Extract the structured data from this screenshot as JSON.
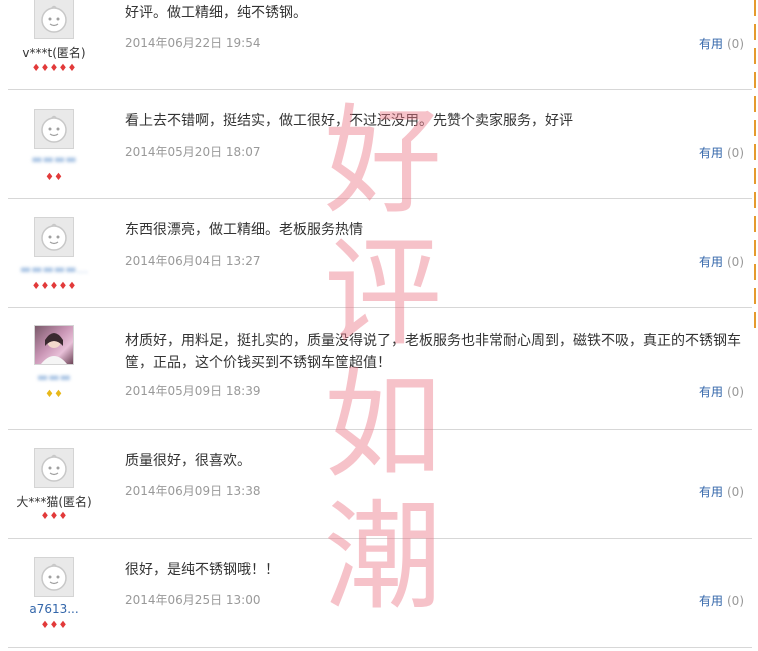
{
  "reviews": [
    {
      "username": "v***t(匿名)",
      "rank": "♦♦♦♦♦",
      "comment": "好评。做工精细，纯不锈钢。",
      "date": "2014年06月22日 19:54",
      "useful_label": "有用",
      "useful_count": "(0)"
    },
    {
      "username": "",
      "rank": "♦♦",
      "comment": "看上去不错啊，挺结实，做工很好，不过还没用。先赞个卖家服务，好评",
      "date": "2014年05月20日 18:07",
      "useful_label": "有用",
      "useful_count": "(0)"
    },
    {
      "username": "",
      "rank": "♦♦♦♦♦",
      "comment": "东西很漂亮，做工精细。老板服务热情",
      "date": "2014年06月04日 13:27",
      "useful_label": "有用",
      "useful_count": "(0)"
    },
    {
      "username": "",
      "rank": "♦♦",
      "comment": "材质好，用料足，挺扎实的，质量没得说了，老板服务也非常耐心周到，磁铁不吸，真正的不锈钢车筐，正品，这个价钱买到不锈钢车筐超值！",
      "date": "2014年05月09日 18:39",
      "useful_label": "有用",
      "useful_count": "(0)"
    },
    {
      "username": "大***猫(匿名)",
      "rank": "♦♦♦",
      "comment": "质量很好，很喜欢。",
      "date": "2014年06月09日 13:38",
      "useful_label": "有用",
      "useful_count": "(0)"
    },
    {
      "username": "a7613...",
      "rank": "♦♦♦",
      "comment": "很好，是纯不锈钢哦！！",
      "date": "2014年06月25日 13:00",
      "useful_label": "有用",
      "useful_count": "(0)"
    }
  ],
  "watermark": {
    "chars": [
      "好",
      "评",
      "如",
      "潮"
    ]
  },
  "colors": {
    "link": "#3366aa",
    "date": "#999999",
    "heart_rank": "#e23a3a",
    "diamond_rank": "#e8b81a",
    "watermark": "#ec7887",
    "scroll_marker": "#e59a2e"
  }
}
